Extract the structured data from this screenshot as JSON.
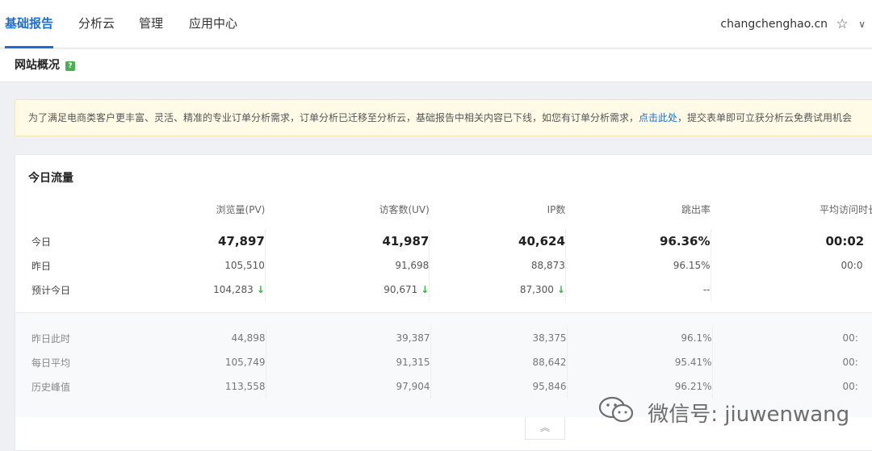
{
  "nav": {
    "items": [
      "基础报告",
      "分析云",
      "管理",
      "应用中心"
    ],
    "site": "changchenghao.cn"
  },
  "page": {
    "title": "网站概况",
    "help": "?"
  },
  "notice": {
    "text_before": "为了满足电商类客户更丰富、灵活、精准的专业订单分析需求，订单分析已迁移至分析云，基础报告中相关内容已下线，如您有订单分析需求，",
    "link": "点击此处",
    "text_after": "，提交表单即可立获分析云免费试用机会"
  },
  "card": {
    "title": "今日流量",
    "headers": [
      "浏览量(PV)",
      "访客数(UV)",
      "IP数",
      "跳出率",
      "平均访问时长"
    ],
    "rows": [
      {
        "label": "今日",
        "values": [
          "47,897",
          "41,987",
          "40,624",
          "96.36%",
          "00:02"
        ]
      },
      {
        "label": "昨日",
        "values": [
          "105,510",
          "91,698",
          "88,873",
          "96.15%",
          "00:0"
        ]
      },
      {
        "label": "预计今日",
        "values": [
          "104,283",
          "90,671",
          "87,300",
          "--",
          ""
        ]
      }
    ],
    "lower_rows": [
      {
        "label": "昨日此时",
        "values": [
          "44,898",
          "39,387",
          "38,375",
          "96.1%",
          "00:"
        ]
      },
      {
        "label": "每日平均",
        "values": [
          "105,749",
          "91,315",
          "88,642",
          "95.41%",
          "00:"
        ]
      },
      {
        "label": "历史峰值",
        "values": [
          "113,558",
          "97,904",
          "95,846",
          "96.21%",
          "00:"
        ]
      }
    ],
    "trend_icon": "arrow-down-icon",
    "trend_color": "#3cb043"
  },
  "watermark": {
    "text": "微信号: jiuwenwang"
  },
  "colors": {
    "accent": "#1a6fd6",
    "notice_bg": "#fffbe6"
  }
}
